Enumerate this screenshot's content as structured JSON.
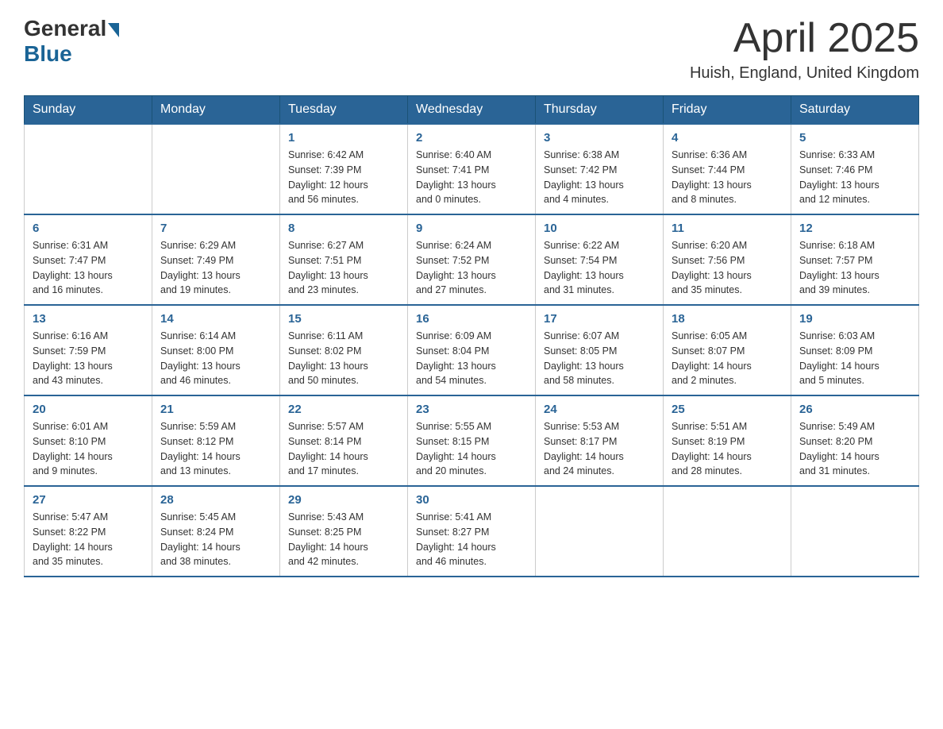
{
  "header": {
    "logo_general": "General",
    "logo_blue": "Blue",
    "title": "April 2025",
    "location": "Huish, England, United Kingdom"
  },
  "days_of_week": [
    "Sunday",
    "Monday",
    "Tuesday",
    "Wednesday",
    "Thursday",
    "Friday",
    "Saturday"
  ],
  "weeks": [
    [
      {
        "day": "",
        "info": ""
      },
      {
        "day": "",
        "info": ""
      },
      {
        "day": "1",
        "info": "Sunrise: 6:42 AM\nSunset: 7:39 PM\nDaylight: 12 hours\nand 56 minutes."
      },
      {
        "day": "2",
        "info": "Sunrise: 6:40 AM\nSunset: 7:41 PM\nDaylight: 13 hours\nand 0 minutes."
      },
      {
        "day": "3",
        "info": "Sunrise: 6:38 AM\nSunset: 7:42 PM\nDaylight: 13 hours\nand 4 minutes."
      },
      {
        "day": "4",
        "info": "Sunrise: 6:36 AM\nSunset: 7:44 PM\nDaylight: 13 hours\nand 8 minutes."
      },
      {
        "day": "5",
        "info": "Sunrise: 6:33 AM\nSunset: 7:46 PM\nDaylight: 13 hours\nand 12 minutes."
      }
    ],
    [
      {
        "day": "6",
        "info": "Sunrise: 6:31 AM\nSunset: 7:47 PM\nDaylight: 13 hours\nand 16 minutes."
      },
      {
        "day": "7",
        "info": "Sunrise: 6:29 AM\nSunset: 7:49 PM\nDaylight: 13 hours\nand 19 minutes."
      },
      {
        "day": "8",
        "info": "Sunrise: 6:27 AM\nSunset: 7:51 PM\nDaylight: 13 hours\nand 23 minutes."
      },
      {
        "day": "9",
        "info": "Sunrise: 6:24 AM\nSunset: 7:52 PM\nDaylight: 13 hours\nand 27 minutes."
      },
      {
        "day": "10",
        "info": "Sunrise: 6:22 AM\nSunset: 7:54 PM\nDaylight: 13 hours\nand 31 minutes."
      },
      {
        "day": "11",
        "info": "Sunrise: 6:20 AM\nSunset: 7:56 PM\nDaylight: 13 hours\nand 35 minutes."
      },
      {
        "day": "12",
        "info": "Sunrise: 6:18 AM\nSunset: 7:57 PM\nDaylight: 13 hours\nand 39 minutes."
      }
    ],
    [
      {
        "day": "13",
        "info": "Sunrise: 6:16 AM\nSunset: 7:59 PM\nDaylight: 13 hours\nand 43 minutes."
      },
      {
        "day": "14",
        "info": "Sunrise: 6:14 AM\nSunset: 8:00 PM\nDaylight: 13 hours\nand 46 minutes."
      },
      {
        "day": "15",
        "info": "Sunrise: 6:11 AM\nSunset: 8:02 PM\nDaylight: 13 hours\nand 50 minutes."
      },
      {
        "day": "16",
        "info": "Sunrise: 6:09 AM\nSunset: 8:04 PM\nDaylight: 13 hours\nand 54 minutes."
      },
      {
        "day": "17",
        "info": "Sunrise: 6:07 AM\nSunset: 8:05 PM\nDaylight: 13 hours\nand 58 minutes."
      },
      {
        "day": "18",
        "info": "Sunrise: 6:05 AM\nSunset: 8:07 PM\nDaylight: 14 hours\nand 2 minutes."
      },
      {
        "day": "19",
        "info": "Sunrise: 6:03 AM\nSunset: 8:09 PM\nDaylight: 14 hours\nand 5 minutes."
      }
    ],
    [
      {
        "day": "20",
        "info": "Sunrise: 6:01 AM\nSunset: 8:10 PM\nDaylight: 14 hours\nand 9 minutes."
      },
      {
        "day": "21",
        "info": "Sunrise: 5:59 AM\nSunset: 8:12 PM\nDaylight: 14 hours\nand 13 minutes."
      },
      {
        "day": "22",
        "info": "Sunrise: 5:57 AM\nSunset: 8:14 PM\nDaylight: 14 hours\nand 17 minutes."
      },
      {
        "day": "23",
        "info": "Sunrise: 5:55 AM\nSunset: 8:15 PM\nDaylight: 14 hours\nand 20 minutes."
      },
      {
        "day": "24",
        "info": "Sunrise: 5:53 AM\nSunset: 8:17 PM\nDaylight: 14 hours\nand 24 minutes."
      },
      {
        "day": "25",
        "info": "Sunrise: 5:51 AM\nSunset: 8:19 PM\nDaylight: 14 hours\nand 28 minutes."
      },
      {
        "day": "26",
        "info": "Sunrise: 5:49 AM\nSunset: 8:20 PM\nDaylight: 14 hours\nand 31 minutes."
      }
    ],
    [
      {
        "day": "27",
        "info": "Sunrise: 5:47 AM\nSunset: 8:22 PM\nDaylight: 14 hours\nand 35 minutes."
      },
      {
        "day": "28",
        "info": "Sunrise: 5:45 AM\nSunset: 8:24 PM\nDaylight: 14 hours\nand 38 minutes."
      },
      {
        "day": "29",
        "info": "Sunrise: 5:43 AM\nSunset: 8:25 PM\nDaylight: 14 hours\nand 42 minutes."
      },
      {
        "day": "30",
        "info": "Sunrise: 5:41 AM\nSunset: 8:27 PM\nDaylight: 14 hours\nand 46 minutes."
      },
      {
        "day": "",
        "info": ""
      },
      {
        "day": "",
        "info": ""
      },
      {
        "day": "",
        "info": ""
      }
    ]
  ]
}
